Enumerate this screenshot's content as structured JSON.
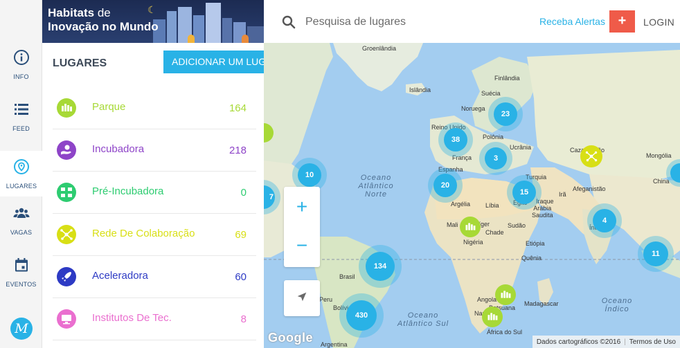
{
  "rail": {
    "items": [
      {
        "label": "INFO",
        "icon": "info-icon"
      },
      {
        "label": "FEED",
        "icon": "feed-icon"
      },
      {
        "label": "LUGARES",
        "icon": "location-icon"
      },
      {
        "label": "VAGAS",
        "icon": "people-icon"
      },
      {
        "label": "EVENTOS",
        "icon": "calendar-icon"
      }
    ],
    "bottom_icon": "m-logo-icon"
  },
  "banner": {
    "line1_bold": "Habitats",
    "line1_rest": "de",
    "line2": "Inovação no Mundo"
  },
  "panel": {
    "title": "LUGARES",
    "add_button": "ADICIONAR UM LUGAR",
    "places": [
      {
        "name": "Parque",
        "count": "164",
        "color": "#a7d936"
      },
      {
        "name": "Incubadora",
        "count": "218",
        "color": "#8e44c8"
      },
      {
        "name": "Pré-Incubadora",
        "count": "0",
        "color": "#2ecc71"
      },
      {
        "name": "Rede De Colaboração",
        "count": "69",
        "color": "#d8df15"
      },
      {
        "name": "Aceleradora",
        "count": "60",
        "color": "#2d3ac4"
      },
      {
        "name": "Institutos De Tec.",
        "count": "8",
        "color": "#ea6fcf"
      }
    ]
  },
  "topbar": {
    "search_placeholder": "Pesquisa de lugares",
    "alerts": "Receba Alertas",
    "plus": "+",
    "login": "LOGIN"
  },
  "map": {
    "labels": {
      "groenlandia": "Groenlândia",
      "islandia": "Islândia",
      "finlandia": "Finlândia",
      "suecia": "Suécia",
      "noruega": "Noruega",
      "reino_unido": "Reino Unido",
      "polonia": "Polônia",
      "ucrania": "Ucrânia",
      "franca": "França",
      "espanha": "Espanha",
      "turquia": "Turquia",
      "iraque": "Iraque",
      "ira": "Irã",
      "afeganistao": "Afeganistão",
      "cazaquistao": "Cazaquistão",
      "mongolia": "Mongólia",
      "china": "China",
      "argelia": "Argélia",
      "libia": "Líbia",
      "egito": "Egito",
      "arabia": "Arábia\nSaudita",
      "mali": "Mali",
      "niger": "Níger",
      "chade": "Chade",
      "sudao": "Sudão",
      "etiopia": "Etiópia",
      "nigeria": "Nigéria",
      "brasil": "Brasil",
      "peru": "Peru",
      "bolivia": "Bolívia",
      "angola": "Angola",
      "namibia": "Namíbia",
      "botsuana": "Botsuana",
      "madagascar": "Madagascar",
      "africa_do_sul": "África do Sul",
      "argentina": "Argentina",
      "india": "Índia",
      "quenia": "Quênia"
    },
    "oceans": {
      "atlantico_norte": "Oceano\nAtlântico\nNorte",
      "atlantico_sul": "Oceano\nAtlântico Sul",
      "indico": "Oceano\nÍndico"
    },
    "clusters": [
      "23",
      "38",
      "3",
      "10",
      "20",
      "15",
      "4",
      "11",
      "134",
      "430",
      "7"
    ],
    "google": "Google",
    "attribution": "Dados cartográficos ©2016",
    "terms": "Termos de Uso"
  }
}
